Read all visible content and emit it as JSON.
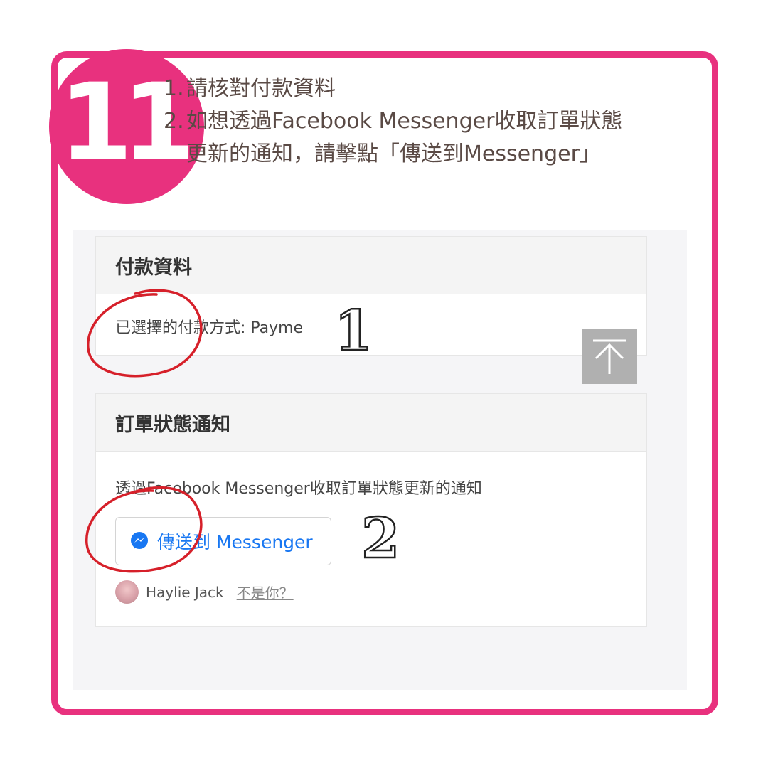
{
  "step_number": "11",
  "instructions": [
    {
      "num": "1.",
      "text": "請核對付款資料"
    },
    {
      "num": "2.",
      "text": "如想透過Facebook Messenger收取訂單狀態",
      "continuation": "更新的通知，請擊點「傳送到Messenger」"
    }
  ],
  "payment_card": {
    "title": "付款資料",
    "selected_method": "已選擇的付款方式: Payme"
  },
  "notification_card": {
    "title": "訂單狀態通知",
    "description": "透過Facebook Messenger收取訂單狀態更新的通知",
    "messenger_button_label": "傳送到 Messenger",
    "user_name": "Haylie Jack",
    "not_you_link": "不是你？"
  },
  "annotations": {
    "first": "1",
    "second": "2"
  },
  "icons": {
    "scroll_top": "arrow-up-to-line-icon",
    "messenger": "messenger-icon"
  },
  "colors": {
    "accent": "#e8317e",
    "messenger_blue": "#1877f2",
    "circle_red": "#d6202a"
  }
}
